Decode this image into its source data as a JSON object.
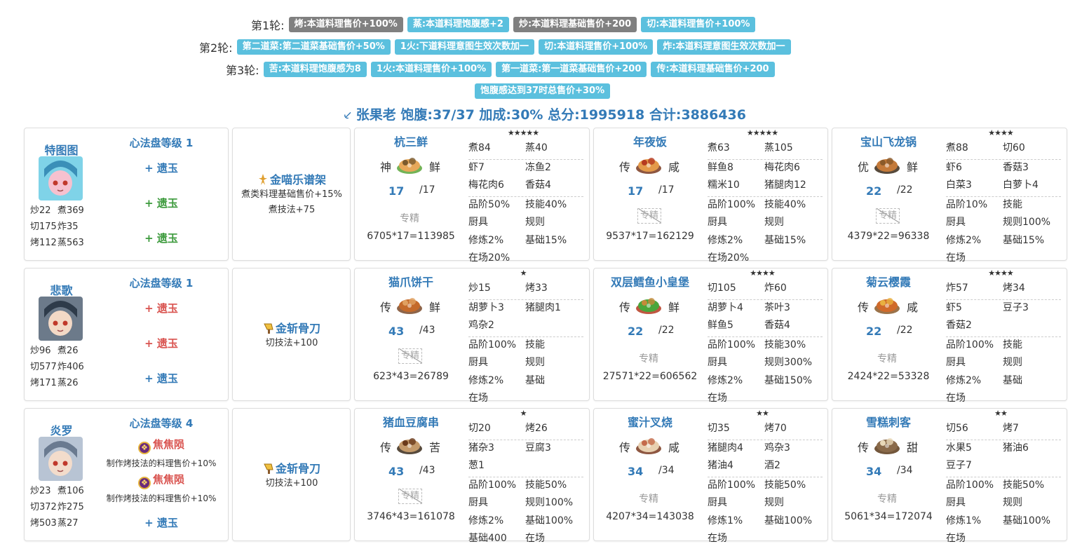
{
  "rounds": [
    {
      "label": "第1轮:",
      "tags": [
        {
          "text": "烤:本道料理售价+100%",
          "color": "gray"
        },
        {
          "text": "蒸:本道料理饱腹感+2",
          "color": "blue"
        },
        {
          "text": "炒:本道料理基础售价+200",
          "color": "gray"
        },
        {
          "text": "切:本道料理售价+100%",
          "color": "blue"
        }
      ]
    },
    {
      "label": "第2轮:",
      "tags": [
        {
          "text": "第二道菜:第二道菜基础售价+50%",
          "color": "blue"
        },
        {
          "text": "1火:下道料理意图生效次数加一",
          "color": "blue"
        },
        {
          "text": "切:本道料理售价+100%",
          "color": "blue"
        },
        {
          "text": "炸:本道料理意图生效次数加一",
          "color": "blue"
        }
      ]
    },
    {
      "label": "第3轮:",
      "tags": [
        {
          "text": "苦:本道料理饱腹感为8",
          "color": "blue"
        },
        {
          "text": "1火:本道料理售价+100%",
          "color": "blue"
        },
        {
          "text": "第一道菜:第一道菜基础售价+200",
          "color": "blue"
        },
        {
          "text": "传:本道料理基础售价+200",
          "color": "blue"
        }
      ]
    },
    {
      "label": "",
      "tags": [
        {
          "text": "饱腹感达到37时总售价+30%",
          "color": "blue"
        }
      ]
    }
  ],
  "summary": {
    "icon": "sword-icon",
    "text": "张果老 饱腹:37/37 加成:30% 总分:1995918 合计:3886436"
  },
  "rows": [
    {
      "chef": {
        "name": "特图图",
        "level": "心法盘等级 1",
        "stats": [
          "炒22",
          "煮369",
          "切175",
          "炸35",
          "烤112",
          "蒸563"
        ],
        "slots": [
          {
            "text": "+ 遗玉",
            "color": "blue"
          },
          {
            "text": "+ 遗玉",
            "color": "green"
          },
          {
            "text": "+ 遗玉",
            "color": "green"
          }
        ]
      },
      "equip": {
        "name": "金喵乐谱架",
        "desc": [
          "煮类料理基础售价+15%",
          "煮技法+75"
        ]
      },
      "recipes": [
        {
          "name": "杭三鲜",
          "stars": "★★★★★",
          "rarity": "神",
          "taste": "鲜",
          "qty": "17",
          "max": "/17",
          "spec": "专精",
          "spec_empty": false,
          "formula": "6705*17=113985",
          "grid": [
            [
              "煮84",
              "蒸40"
            ],
            [
              "虾7",
              "冻鱼2"
            ],
            [
              "梅花肉6",
              "香菇4"
            ],
            [
              "品阶50%",
              "技能40%"
            ],
            [
              "厨具",
              "规则"
            ],
            [
              "修炼2%",
              "基础15%"
            ],
            [
              "在场20%",
              ""
            ]
          ]
        },
        {
          "name": "年夜饭",
          "stars": "★★★★★",
          "rarity": "传",
          "taste": "咸",
          "qty": "17",
          "max": "/17",
          "spec": "专精",
          "spec_empty": true,
          "formula": "9537*17=162129",
          "grid": [
            [
              "煮63",
              "蒸105"
            ],
            [
              "鲜鱼8",
              "梅花肉6"
            ],
            [
              "糯米10",
              "猪腿肉12"
            ],
            [
              "品阶100%",
              "技能40%"
            ],
            [
              "厨具",
              "规则"
            ],
            [
              "修炼2%",
              "基础15%"
            ],
            [
              "在场20%",
              ""
            ]
          ]
        },
        {
          "name": "宝山飞龙锅",
          "stars": "★★★★",
          "rarity": "优",
          "taste": "鲜",
          "qty": "22",
          "max": "/22",
          "spec": "专精",
          "spec_empty": true,
          "formula": "4379*22=96338",
          "grid": [
            [
              "煮88",
              "切60"
            ],
            [
              "虾6",
              "香菇3"
            ],
            [
              "白菜3",
              "白萝卜4"
            ],
            [
              "品阶10%",
              "技能"
            ],
            [
              "厨具",
              "规则100%"
            ],
            [
              "修炼2%",
              "基础15%"
            ],
            [
              "在场",
              ""
            ]
          ]
        }
      ]
    },
    {
      "chef": {
        "name": "悲歌",
        "level": "心法盘等级 1",
        "stats": [
          "炒96",
          "煮26",
          "切577",
          "炸406",
          "烤171",
          "蒸26"
        ],
        "slots": [
          {
            "text": "+ 遗玉",
            "color": "red"
          },
          {
            "text": "+ 遗玉",
            "color": "red"
          },
          {
            "text": "+ 遗玉",
            "color": "blue"
          }
        ]
      },
      "equip": {
        "name": "金斩骨刀",
        "desc": [
          "切技法+100"
        ]
      },
      "recipes": [
        {
          "name": "猫爪饼干",
          "stars": "★",
          "rarity": "传",
          "taste": "鲜",
          "qty": "43",
          "max": "/43",
          "spec": "专精",
          "spec_empty": true,
          "formula": "623*43=26789",
          "grid": [
            [
              "炒15",
              "烤33"
            ],
            [
              "胡萝卜3",
              "猪腿肉1"
            ],
            [
              "鸡杂2",
              ""
            ],
            [
              "品阶100%",
              "技能"
            ],
            [
              "厨具",
              "规则"
            ],
            [
              "修炼2%",
              "基础"
            ],
            [
              "在场",
              ""
            ]
          ]
        },
        {
          "name": "双层鳕鱼小皇堡",
          "stars": "★★★★",
          "rarity": "传",
          "taste": "鲜",
          "qty": "22",
          "max": "/22",
          "spec": "专精",
          "spec_empty": false,
          "formula": "27571*22=606562",
          "grid": [
            [
              "切105",
              "炸60"
            ],
            [
              "胡萝卜4",
              "茶叶3"
            ],
            [
              "鲜鱼5",
              "香菇4"
            ],
            [
              "品阶100%",
              "技能30%"
            ],
            [
              "厨具",
              "规则300%"
            ],
            [
              "修炼2%",
              "基础150%"
            ],
            [
              "在场",
              ""
            ]
          ]
        },
        {
          "name": "菊云樱霞",
          "stars": "★★★★",
          "rarity": "传",
          "taste": "咸",
          "qty": "22",
          "max": "/22",
          "spec": "专精",
          "spec_empty": false,
          "formula": "2424*22=53328",
          "grid": [
            [
              "炸57",
              "烤34"
            ],
            [
              "虾5",
              "豆子3"
            ],
            [
              "香菇2",
              ""
            ],
            [
              "品阶100%",
              "技能"
            ],
            [
              "厨具",
              "规则"
            ],
            [
              "修炼2%",
              "基础"
            ],
            [
              "在场",
              ""
            ]
          ]
        }
      ]
    },
    {
      "chef": {
        "name": "炎罗",
        "level": "心法盘等级 4",
        "stats": [
          "炒23",
          "煮106",
          "切372",
          "炸275",
          "烤503",
          "蒸27"
        ],
        "ambers": [
          {
            "name": "焦焦陨",
            "desc": "制作烤技法的料理售价+10%"
          },
          {
            "name": "焦焦陨",
            "desc": "制作烤技法的料理售价+10%"
          }
        ],
        "slots": [
          {
            "text": "+ 遗玉",
            "color": "blue"
          }
        ]
      },
      "equip": {
        "name": "金斩骨刀",
        "desc": [
          "切技法+100"
        ]
      },
      "recipes": [
        {
          "name": "猪血豆腐串",
          "stars": "★",
          "rarity": "传",
          "taste": "苦",
          "qty": "43",
          "max": "/43",
          "spec": "专精",
          "spec_empty": true,
          "formula": "3746*43=161078",
          "grid": [
            [
              "切20",
              "烤26"
            ],
            [
              "猪杂3",
              "豆腐3"
            ],
            [
              "葱1",
              ""
            ],
            [
              "品阶100%",
              "技能50%"
            ],
            [
              "厨具",
              "规则100%"
            ],
            [
              "修炼2%",
              "基础100%"
            ],
            [
              "基础400",
              "在场"
            ]
          ]
        },
        {
          "name": "蜜汁叉烧",
          "stars": "★★",
          "rarity": "传",
          "taste": "咸",
          "qty": "34",
          "max": "/34",
          "spec": "专精",
          "spec_empty": false,
          "formula": "4207*34=143038",
          "grid": [
            [
              "切35",
              "烤70"
            ],
            [
              "猪腿肉4",
              "鸡杂3"
            ],
            [
              "猪油4",
              "酒2"
            ],
            [
              "品阶100%",
              "技能50%"
            ],
            [
              "厨具",
              "规则"
            ],
            [
              "修炼1%",
              "基础100%"
            ],
            [
              "在场",
              ""
            ]
          ]
        },
        {
          "name": "雪糕刺客",
          "stars": "★★",
          "rarity": "传",
          "taste": "甜",
          "qty": "34",
          "max": "/34",
          "spec": "专精",
          "spec_empty": false,
          "formula": "5061*34=172074",
          "grid": [
            [
              "切56",
              "烤7"
            ],
            [
              "水果5",
              "猪油6"
            ],
            [
              "豆子7",
              ""
            ],
            [
              "品阶100%",
              "技能50%"
            ],
            [
              "厨具",
              "规则"
            ],
            [
              "修炼1%",
              "基础100%"
            ],
            [
              "在场",
              ""
            ]
          ]
        }
      ]
    }
  ],
  "colors": {
    "accent": "#337ab7",
    "tag_gray": "#808080",
    "tag_blue": "#5bc0de",
    "red": "#d9534f",
    "green": "#3c9a3c"
  }
}
